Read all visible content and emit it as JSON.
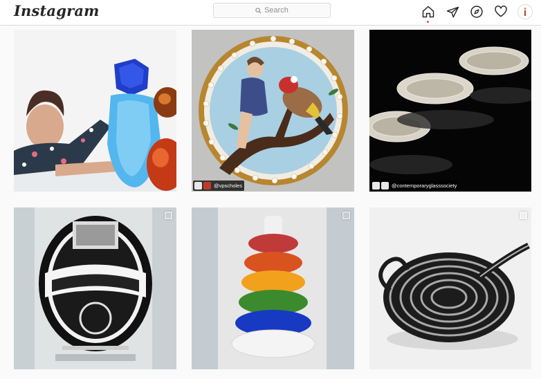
{
  "app": {
    "logo": "Instagram"
  },
  "search": {
    "placeholder": "Search"
  },
  "nav": {
    "icons": [
      "home-icon",
      "direct-icon",
      "explore-icon",
      "activity-icon",
      "profile-avatar"
    ],
    "active": "home-icon",
    "notification_dot_color": "#ed4956"
  },
  "posts": [
    {
      "subject": "woman with blue and amber glass vessels",
      "multi": false,
      "tags": []
    },
    {
      "subject": "painted brooch with birds and figure",
      "multi": false,
      "tags": [
        "@vpscholes"
      ]
    },
    {
      "subject": "white lace glass bowls",
      "multi": false,
      "tags": [
        "@contemporaryglasssociety"
      ]
    },
    {
      "subject": "engraved glass oval sign",
      "multi": true,
      "tags": []
    },
    {
      "subject": "stacked colored glass rings",
      "multi": true,
      "tags": []
    },
    {
      "subject": "striped black glass teapot",
      "multi": true,
      "tags": []
    }
  ],
  "labels": {
    "tag_post2": "@vpscholes",
    "tag_post3": "@contemporaryglasssociety"
  }
}
